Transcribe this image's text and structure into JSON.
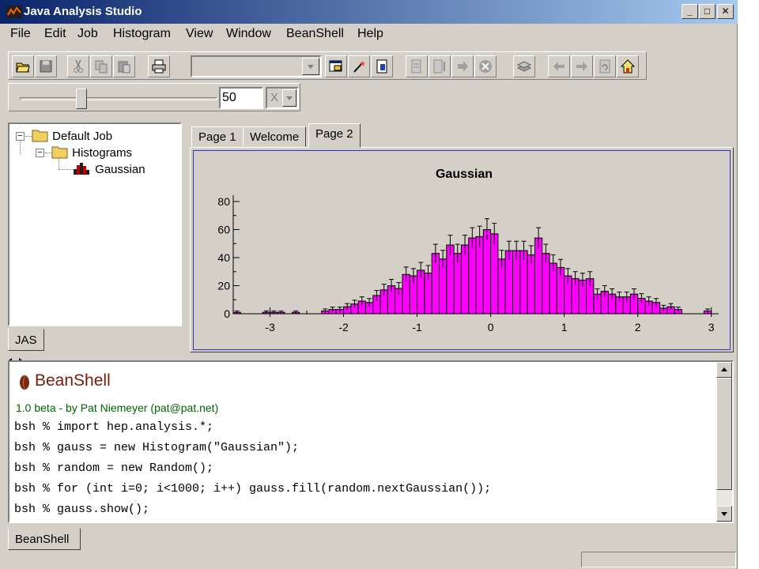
{
  "window": {
    "title": "Java Analysis Studio",
    "icon": "jas-app-icon",
    "controls": {
      "minimize": "_",
      "maximize": "□",
      "close": "✕"
    }
  },
  "menu": {
    "items": [
      "File",
      "Edit",
      "Job",
      "Histogram",
      "View",
      "Window",
      "BeanShell",
      "Help"
    ]
  },
  "toolbar": {
    "buttons": [
      "open-folder-icon",
      "save-icon",
      "cut-icon",
      "copy-icon",
      "paste-icon",
      "print-icon",
      "show-plot-icon",
      "wizard-icon",
      "page-icon",
      "job-setup-icon",
      "job-list-icon",
      "go-icon",
      "stop-icon",
      "stack-icon",
      "back-icon",
      "forward-icon",
      "refresh-icon",
      "home-icon"
    ],
    "combo_value": ""
  },
  "slider": {
    "value": "50",
    "fraction": 0.3,
    "unit_value": "X"
  },
  "tree": {
    "root": "Default Job",
    "folder": "Histograms",
    "leaf": "Gaussian",
    "tab": "JAS"
  },
  "page_tabs": [
    "Page 1",
    "Welcome",
    "Page 2"
  ],
  "active_tab": 2,
  "chart_data": {
    "type": "bar",
    "title": "Gaussian",
    "xlabel": "",
    "ylabel": "",
    "xlim": [
      -3.5,
      3.1
    ],
    "ylim": [
      0,
      80
    ],
    "xticks": [
      "-3",
      "-2",
      "-1",
      "0",
      "1",
      "2",
      "3"
    ],
    "yticks": [
      "0",
      "20",
      "40",
      "60",
      "80"
    ],
    "bin_width": 0.1,
    "bin_start": -3.5,
    "bar_color": "#ff00ff",
    "values": [
      1,
      0,
      0,
      0,
      1,
      1,
      1,
      0,
      1,
      0,
      0,
      0,
      2,
      3,
      3,
      5,
      7,
      9,
      8,
      13,
      17,
      20,
      18,
      28,
      27,
      31,
      29,
      43,
      39,
      49,
      43,
      49,
      54,
      55,
      60,
      57,
      39,
      45,
      45,
      45,
      42,
      54,
      43,
      36,
      33,
      27,
      25,
      24,
      25,
      14,
      16,
      14,
      12,
      12,
      14,
      11,
      9,
      8,
      4,
      5,
      3,
      0,
      0,
      0,
      2,
      0
    ],
    "error_bars": true
  },
  "console": {
    "title": "BeanShell",
    "subtitle": "1.0 beta - by Pat Niemeyer (pat@pat.net)",
    "lines": [
      "bsh % import hep.analysis.*;",
      "bsh % gauss = new Histogram(\"Gaussian\");",
      "bsh % random = new Random();",
      "bsh % for (int i=0; i<1000; i++) gauss.fill(random.nextGaussian());",
      "bsh % gauss.show();"
    ],
    "tab": "BeanShell"
  }
}
